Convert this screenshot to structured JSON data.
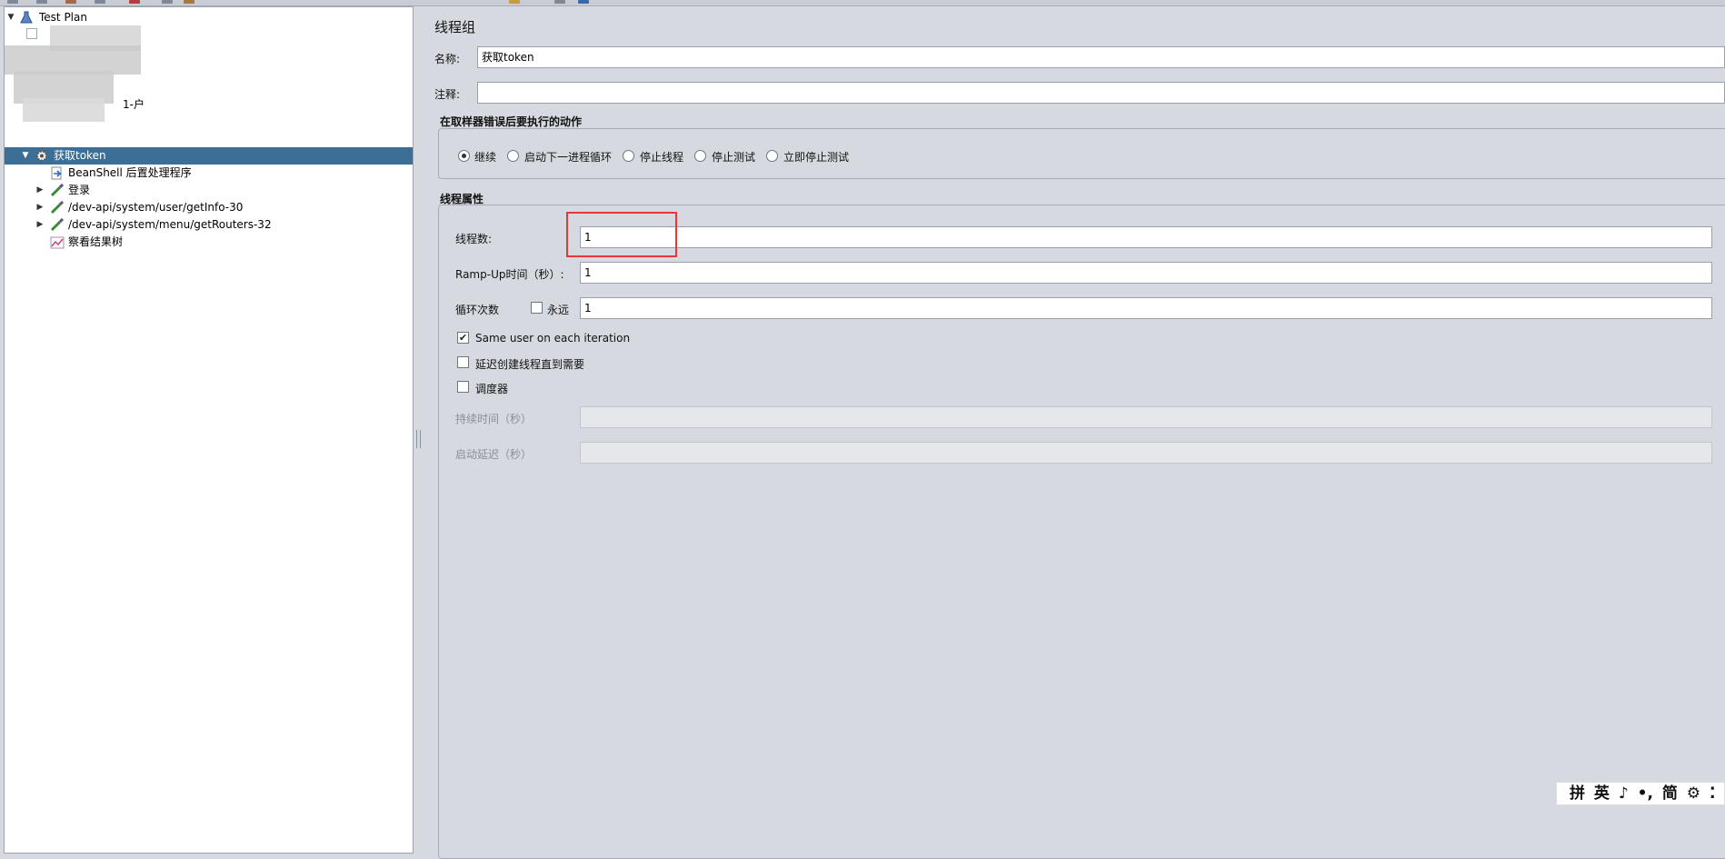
{
  "tree": {
    "root_label": "Test Plan",
    "selected_label": "获取token",
    "partial_label": "1-户",
    "children": [
      {
        "label": "BeanShell 后置处理程序",
        "icon": "beanshell-arrow-icon",
        "expandable": false
      },
      {
        "label": "登录",
        "icon": "http-sampler-pipette-icon",
        "expandable": true
      },
      {
        "label": "/dev-api/system/user/getInfo-30",
        "icon": "http-sampler-pipette-icon",
        "expandable": true
      },
      {
        "label": "/dev-api/system/menu/getRouters-32",
        "icon": "http-sampler-pipette-icon",
        "expandable": true
      },
      {
        "label": "察看结果树",
        "icon": "results-tree-chart-icon",
        "expandable": false
      }
    ]
  },
  "panel": {
    "title": "线程组",
    "name_label": "名称:",
    "name_value": "获取token",
    "comment_label": "注释:",
    "comment_value": ""
  },
  "error_action": {
    "title": "在取样器错误后要执行的动作",
    "options": [
      "继续",
      "启动下一进程循环",
      "停止线程",
      "停止测试",
      "立即停止测试"
    ],
    "selected": "继续"
  },
  "thread_props": {
    "title": "线程属性",
    "threads_label": "线程数:",
    "threads_value": "1",
    "rampup_label": "Ramp-Up时间（秒）:",
    "rampup_value": "1",
    "loop_label": "循环次数",
    "forever_label": "永远",
    "forever_checked": false,
    "loop_value": "1",
    "same_user_label": "Same user on each iteration",
    "same_user_checked": true,
    "delay_label": "延迟创建线程直到需要",
    "delay_checked": false,
    "scheduler_label": "调度器",
    "scheduler_checked": false,
    "duration_label": "持续时间（秒）",
    "duration_value": "",
    "startup_delay_label": "启动延迟（秒）",
    "startup_delay_value": ""
  },
  "ime": {
    "items": [
      "拼",
      "英",
      "♪",
      "•,",
      "简",
      "⚙",
      "⁚"
    ]
  },
  "colors": {
    "selection": "#3d6e96",
    "highlight": "#e53935",
    "background": "#d6d9df"
  }
}
